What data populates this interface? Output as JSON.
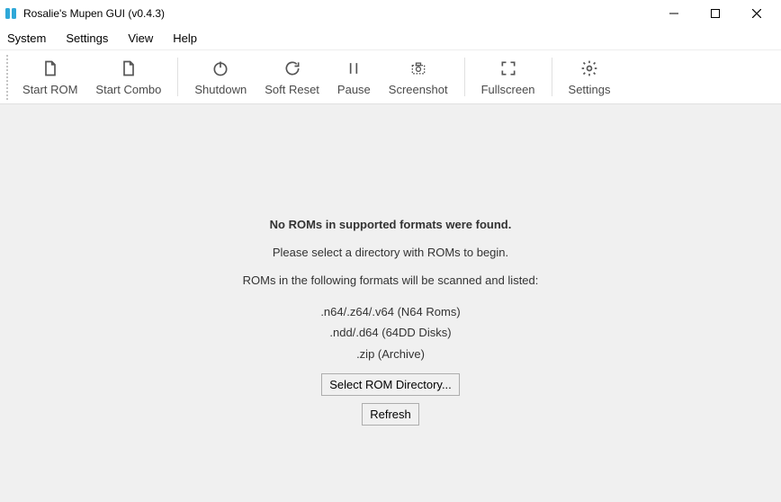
{
  "window": {
    "title": "Rosalie's Mupen GUI (v0.4.3)"
  },
  "menubar": {
    "items": [
      "System",
      "Settings",
      "View",
      "Help"
    ]
  },
  "toolbar": {
    "start_rom": "Start ROM",
    "start_combo": "Start Combo",
    "shutdown": "Shutdown",
    "soft_reset": "Soft Reset",
    "pause": "Pause",
    "screenshot": "Screenshot",
    "fullscreen": "Fullscreen",
    "settings": "Settings"
  },
  "content": {
    "heading": "No ROMs in supported formats were found.",
    "subheading": "Please select a directory with ROMs to begin.",
    "scanned_intro": "ROMs in the following formats will be scanned and listed:",
    "line1": ".n64/.z64/.v64 (N64 Roms)",
    "line2": ".ndd/.d64 (64DD Disks)",
    "line3": ".zip (Archive)",
    "select_button": "Select ROM Directory...",
    "refresh_button": "Refresh"
  }
}
